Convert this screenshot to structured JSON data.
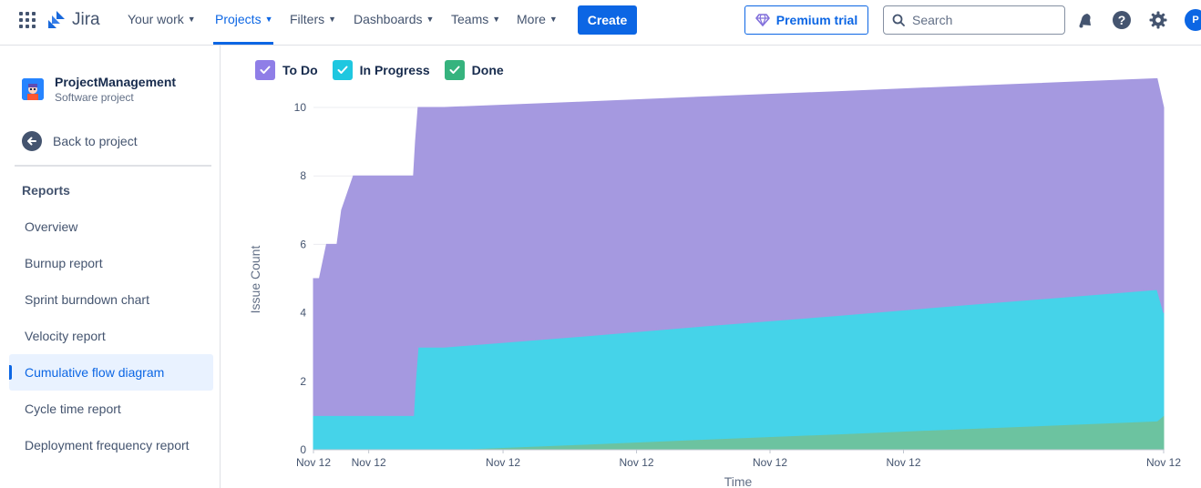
{
  "topnav": {
    "logo": "Jira",
    "items": [
      {
        "label": "Your work"
      },
      {
        "label": "Projects"
      },
      {
        "label": "Filters"
      },
      {
        "label": "Dashboards"
      },
      {
        "label": "Teams"
      },
      {
        "label": "More"
      }
    ],
    "create_label": "Create",
    "premium_label": "Premium trial",
    "search_placeholder": "Search",
    "avatar_initial": "P"
  },
  "sidebar": {
    "project_name": "ProjectManagement",
    "project_type": "Software project",
    "back_label": "Back to project",
    "section_title": "Reports",
    "items": [
      {
        "label": "Overview"
      },
      {
        "label": "Burnup report"
      },
      {
        "label": "Sprint burndown chart"
      },
      {
        "label": "Velocity report"
      },
      {
        "label": "Cumulative flow diagram",
        "selected": true
      },
      {
        "label": "Cycle time report"
      },
      {
        "label": "Deployment frequency report"
      }
    ]
  },
  "legend": [
    {
      "label": "To Do",
      "color": "#8f7ee7"
    },
    {
      "label": "In Progress",
      "color": "#1d9aaa"
    },
    {
      "label": "Done",
      "color": "#36b37e"
    }
  ],
  "chart_data": {
    "type": "area",
    "stacked": true,
    "xlabel": "Time",
    "ylabel": "Issue Count",
    "ylim": [
      0,
      10
    ],
    "y_ticks": [
      0,
      2,
      4,
      6,
      8,
      10
    ],
    "x_tick_labels": [
      "Nov 12",
      "Nov 12",
      "Nov 12",
      "Nov 12",
      "Nov 12",
      "Nov 12",
      "Nov 12"
    ],
    "x": [
      0,
      0.04,
      0.09,
      0.2,
      0.36,
      0.43,
      0.61,
      0.64,
      0.65,
      1.53,
      1.56,
      1.6,
      2,
      4,
      6,
      8,
      10,
      12,
      12.9,
      13
    ],
    "series": [
      {
        "name": "Done",
        "color": "#6cc3a0",
        "values": [
          0,
          0,
          0,
          0,
          0,
          0,
          0,
          0,
          0,
          0,
          0,
          0,
          0,
          0.15,
          0.31,
          0.46,
          0.62,
          0.77,
          0.84,
          1
        ]
      },
      {
        "name": "In Progress",
        "color": "#45d3e9",
        "values": [
          1,
          1,
          1,
          1,
          1,
          1,
          1,
          1,
          1,
          1,
          2,
          3,
          3,
          3.15,
          3.31,
          3.46,
          3.62,
          3.77,
          3.84,
          3
        ]
      },
      {
        "name": "To Do",
        "color": "#a599e0",
        "values": [
          4,
          4,
          4,
          5,
          5,
          6,
          7,
          7,
          7,
          7,
          7,
          7,
          7,
          6.85,
          6.69,
          6.54,
          6.38,
          6.23,
          6.16,
          6
        ]
      }
    ]
  }
}
